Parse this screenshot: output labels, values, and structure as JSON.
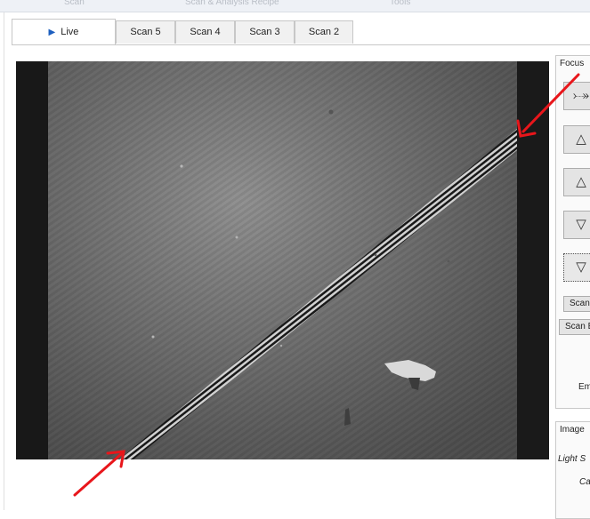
{
  "top_menu": [
    "Scan",
    "Scan & Analysis Recipe",
    "Tools"
  ],
  "tabs": [
    {
      "label": "Live",
      "icon": "play-icon",
      "active": true
    },
    {
      "label": "Scan 5"
    },
    {
      "label": "Scan 4"
    },
    {
      "label": "Scan 3"
    },
    {
      "label": "Scan 2"
    }
  ],
  "focus_panel": {
    "title": "Focus",
    "buttons": [
      "focus-top-icon",
      "focus-up-fast-icon",
      "focus-up-icon",
      "focus-down-icon",
      "focus-down-fast-icon"
    ],
    "scan_button": "Scan",
    "scan_b_button": "Scan B",
    "em_label": "Em"
  },
  "image_panel": {
    "title": "Image",
    "light_source_label": "Light S",
    "ca_label": "Ca"
  },
  "colors": {
    "annotation_arrow": "#e8161b",
    "accent_play": "#1d5fbf"
  }
}
